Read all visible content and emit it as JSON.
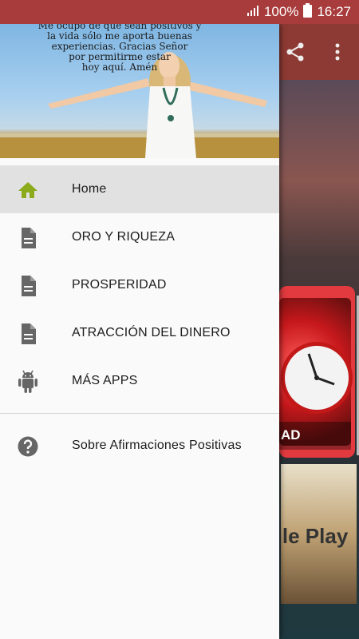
{
  "status_bar": {
    "battery_percent": "100%",
    "time": "16:27"
  },
  "header": {
    "quote": "Me ocupo de que sean positivos y\nla vida sólo me aporta buenas\nexperiencias. Gracias Señor\npor permitirme estar\nhoy aquí. Amén"
  },
  "menu": {
    "items": [
      {
        "label": "Home",
        "icon": "home-icon",
        "active": true
      },
      {
        "label": "ORO Y RIQUEZA",
        "icon": "document-icon"
      },
      {
        "label": "PROSPERIDAD",
        "icon": "document-icon"
      },
      {
        "label": "ATRACCIÓN DEL DINERO",
        "icon": "document-icon"
      },
      {
        "label": "MÁS APPS",
        "icon": "android-icon"
      }
    ],
    "secondary": [
      {
        "label": "Sobre Afirmaciones Positivas",
        "icon": "help-icon"
      }
    ]
  },
  "background_app": {
    "card_clock_label": "AD",
    "card_play_label": "gle Play"
  },
  "colors": {
    "status_bar": "#a83b3b",
    "toolbar": "#8e3a34",
    "home_icon": "#8bab1d",
    "menu_icon": "#666666",
    "active_row": "#e1e1e1"
  }
}
